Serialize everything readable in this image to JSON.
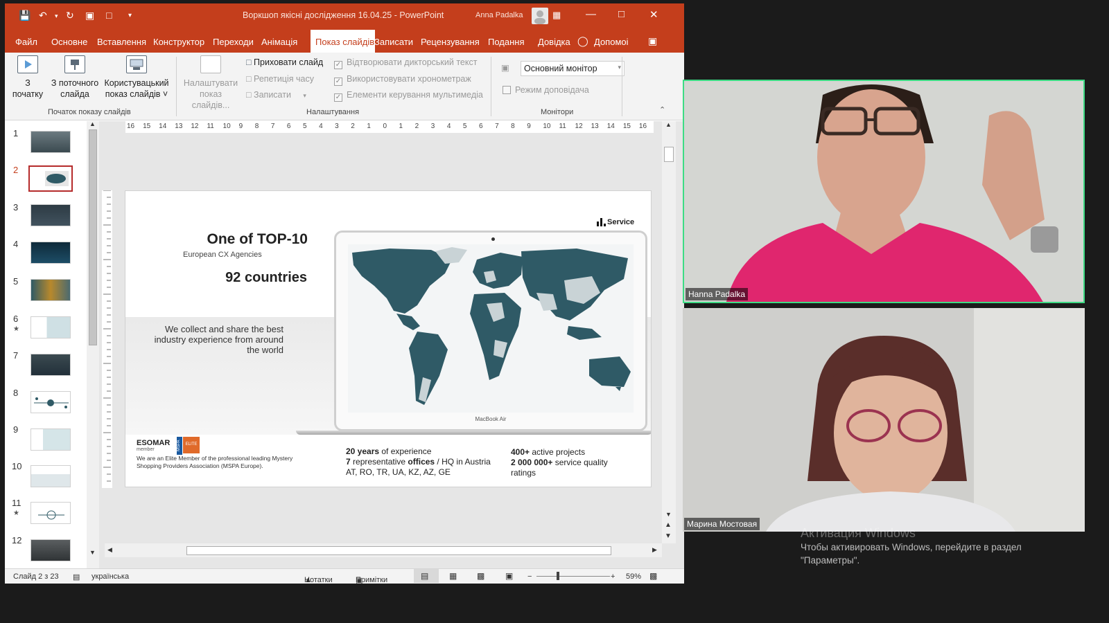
{
  "window": {
    "title": "Воркшоп якісні дослідження 16.04.25  -  PowerPoint",
    "user": "Anna Padalka"
  },
  "menu": {
    "items": [
      "Файл",
      "Основне",
      "Вставлення",
      "Конструктор",
      "Переходи",
      "Анімація",
      "Показ слайдів",
      "Записати",
      "Рецензування",
      "Подання",
      "Довідка",
      "Допомоі"
    ],
    "active": "Показ слайдів"
  },
  "ribbon": {
    "from_start": "З початку",
    "from_start_l1": "З",
    "from_start_l2": "початку",
    "from_current_l1": "З поточного",
    "from_current_l2": "слайда",
    "custom_l1": "Користувацький",
    "custom_l2": "показ слайдів ˅",
    "setup_l1": "Налаштувати",
    "setup_l2": "показ слайдів...",
    "hide_slide": "Приховати слайд",
    "rehearse": "Репетиція часу",
    "record": "Записати",
    "play_narration": "Відтворювати дикторський текст",
    "use_timings": "Використовувати хронометраж",
    "media_controls": "Елементи керування мультимедіа",
    "monitor_value": "Основний монітор",
    "presenter_view": "Режим доповідача",
    "group_start": "Початок показу слайдів",
    "group_setup": "Налаштування",
    "group_monitors": "Монітори"
  },
  "thumbnails": {
    "numbers": [
      "1",
      "2",
      "3",
      "4",
      "5",
      "6",
      "7",
      "8",
      "9",
      "10",
      "11",
      "12"
    ],
    "selected": "2"
  },
  "ruler": {
    "marks": [
      "16",
      "15",
      "14",
      "13",
      "12",
      "11",
      "10",
      "9",
      "8",
      "7",
      "6",
      "5",
      "4",
      "3",
      "2",
      "1",
      "0",
      "1",
      "2",
      "3",
      "4",
      "5",
      "6",
      "7",
      "8",
      "9",
      "10",
      "11",
      "12",
      "13",
      "14",
      "15",
      "16"
    ]
  },
  "slide": {
    "title": "One of TOP-10",
    "subtitle": "European CX Agencies",
    "countries": "92 countries",
    "tagline": "We collect and share the best industry experience from around the world",
    "logo": "Service",
    "laptop_label": "MacBook Air",
    "esomar": "ESOMAR",
    "esomar_member": "member",
    "mspa": "MSPA",
    "elite": "ELITE",
    "member_text": "We are an Elite Member of the professional leading Mystery Shopping Providers Association (MSPA Europe).",
    "stat1_b": "20 years",
    "stat1_r": " of experience",
    "stat2_b": "7",
    "stat2_r1": " representative ",
    "stat2_b2": "offices",
    "stat2_r2": " / HQ in Austria",
    "stat3": "AT, RO, TR, UA, KZ, AZ, GE",
    "stat4_b": "400+",
    "stat4_r": " active projects",
    "stat5_b": "2 000 000+",
    "stat5_r": " service quality",
    "stat6": "ratings"
  },
  "status": {
    "slide": "Слайд 2 з 23",
    "language": "українська",
    "notes": "Нотатки",
    "comments": "Примітки",
    "zoom": "59%"
  },
  "videos": {
    "person1": "Hanna Padalka",
    "person2": "Марина Мостовая"
  },
  "watermark": {
    "line1": "Активация Windows",
    "line2": "Чтобы активировать Windows, перейдите в раздел",
    "line3": "\"Параметры\"."
  },
  "colors": {
    "accent": "#c43e1c",
    "map_land": "#2f5a66",
    "map_light": "#c9d3d6",
    "active_speaker": "#3ddc84"
  }
}
